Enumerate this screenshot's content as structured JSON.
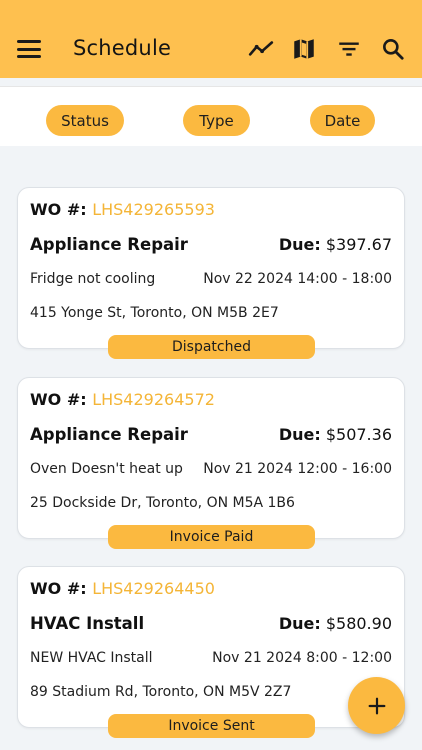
{
  "header": {
    "title": "Schedule",
    "icons": [
      "menu-icon",
      "trend-icon",
      "map-icon",
      "filter-icon",
      "search-icon"
    ],
    "background": "#fec04f"
  },
  "filters": {
    "status": "Status",
    "type": "Type",
    "date": "Date"
  },
  "wo_prefix": "WO #:",
  "due_prefix": "Due:",
  "work_orders": [
    {
      "number": "LHS429265593",
      "service": "Appliance Repair",
      "due": "$397.67",
      "description": "Fridge not cooling",
      "time": "Nov 22 2024 14:00 - 18:00",
      "address": "415 Yonge St, Toronto, ON M5B 2E7",
      "status": "Dispatched"
    },
    {
      "number": "LHS429264572",
      "service": "Appliance Repair",
      "due": "$507.36",
      "description": "Oven Doesn't heat up",
      "time": "Nov 21 2024 12:00 - 16:00",
      "address": "25 Dockside Dr, Toronto, ON M5A 1B6",
      "status": "Invoice Paid"
    },
    {
      "number": "LHS429264450",
      "service": "HVAC Install",
      "due": "$580.90",
      "description": "NEW HVAC Install",
      "time": "Nov 21 2024 8:00 - 12:00",
      "address": "89 Stadium Rd, Toronto, ON M5V 2Z7",
      "status": "Invoice Sent"
    }
  ],
  "colors": {
    "accent": "#fbb940",
    "wo_number": "#f4b537",
    "background": "#f1f4f7"
  },
  "fab_icon": "plus-icon"
}
